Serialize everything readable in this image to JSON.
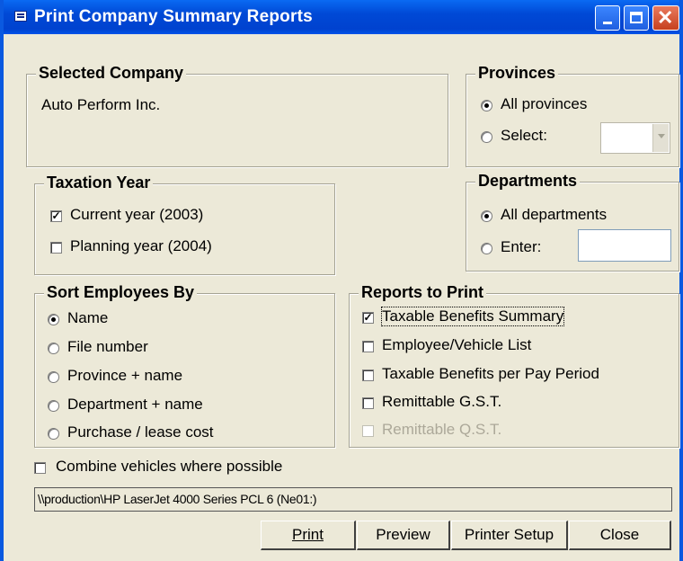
{
  "window": {
    "title": "Print Company Summary Reports"
  },
  "selected_company": {
    "legend": "Selected Company",
    "name": "Auto Perform Inc."
  },
  "provinces": {
    "legend": "Provinces",
    "option_all": "All provinces",
    "option_select": "Select:",
    "select_value": "",
    "selected": "all"
  },
  "taxation_year": {
    "legend": "Taxation Year",
    "current": "Current year (2003)",
    "current_checked": true,
    "planning": "Planning year (2004)",
    "planning_checked": false
  },
  "departments": {
    "legend": "Departments",
    "option_all": "All departments",
    "option_enter": "Enter:",
    "enter_value": "",
    "selected": "all"
  },
  "sort_by": {
    "legend": "Sort Employees By",
    "options": [
      "Name",
      "File number",
      "Province + name",
      "Department + name",
      "Purchase / lease cost"
    ],
    "selected": "Name"
  },
  "reports": {
    "legend": "Reports to Print",
    "items": [
      {
        "label": "Taxable Benefits Summary",
        "checked": true,
        "enabled": true
      },
      {
        "label": "Employee/Vehicle  List",
        "checked": false,
        "enabled": true
      },
      {
        "label": "Taxable Benefits per Pay Period",
        "checked": false,
        "enabled": true
      },
      {
        "label": "Remittable G.S.T.",
        "checked": false,
        "enabled": true
      },
      {
        "label": "Remittable Q.S.T.",
        "checked": false,
        "enabled": false
      }
    ]
  },
  "combine": {
    "label": "Combine vehicles where possible",
    "checked": false
  },
  "printer": {
    "name": "\\\\production\\HP LaserJet 4000 Series PCL 6 (Ne01:)"
  },
  "buttons": {
    "print": "Print",
    "preview": "Preview",
    "setup": "Printer Setup",
    "close": "Close"
  },
  "colors": {
    "title_bar": "#0054e3",
    "dialog_bg": "#ece9d8"
  }
}
